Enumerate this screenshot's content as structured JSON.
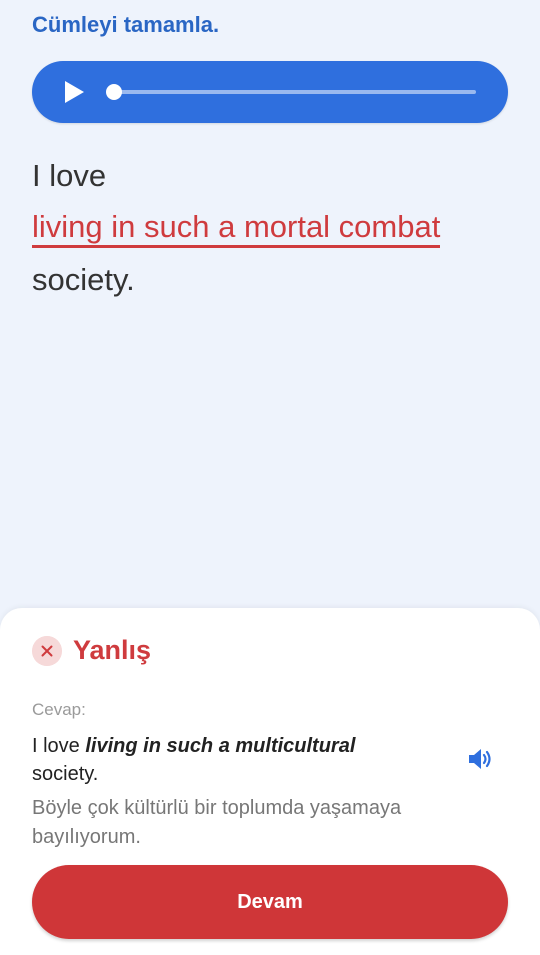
{
  "header": {
    "title": "Cümleyi tamamla."
  },
  "audio_player": {
    "progress": 0,
    "accent_color": "#2f6fde",
    "play_icon": "play-icon"
  },
  "sentence": {
    "prefix": "I love",
    "user_answer": "living in such a mortal combat",
    "suffix": "society.",
    "answer_color": "#cf3b3e"
  },
  "feedback": {
    "status_icon": "close-icon",
    "status_label": "Yanlış",
    "answer_caption": "Cevap:",
    "correct_prefix": "I love ",
    "correct_answer": "living in such a multicultural",
    "correct_suffix": " society.",
    "speaker_icon": "speaker-icon",
    "translation": "Böyle çok kültürlü bir toplumda yaşamaya bayılıyorum.",
    "continue_label": "Devam",
    "error_color": "#cf3638"
  }
}
